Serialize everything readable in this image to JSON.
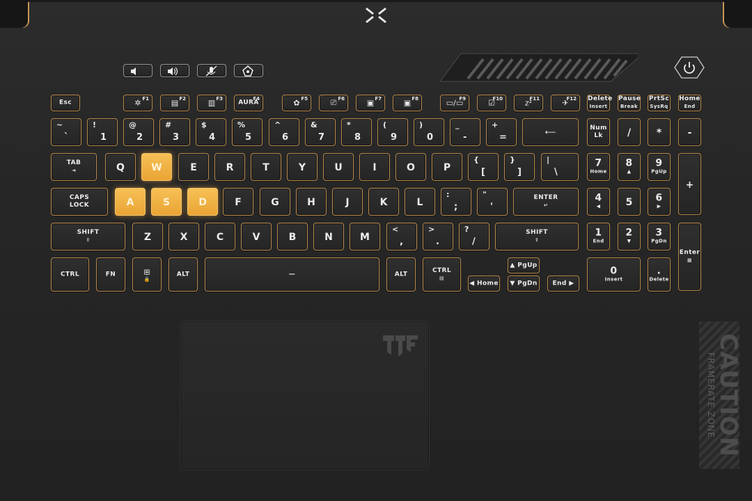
{
  "colors": {
    "accent": "#d4a061",
    "highlight": "#f2b548",
    "body": "#262626"
  },
  "hotkeys": [
    {
      "id": "vol-down",
      "icon": "volume-down-icon"
    },
    {
      "id": "vol-up",
      "icon": "volume-up-icon"
    },
    {
      "id": "mic-mute",
      "icon": "mic-mute-icon"
    },
    {
      "id": "armoury",
      "icon": "armoury-crate-icon"
    }
  ],
  "rows": {
    "fn": [
      {
        "label": "Esc"
      },
      {
        "fn": "F1",
        "icon": "✲"
      },
      {
        "fn": "F2",
        "icon": "▤"
      },
      {
        "fn": "F3",
        "icon": "▥"
      },
      {
        "fn": "F4",
        "label": "AURA"
      },
      {
        "fn": "F5",
        "icon": "✿"
      },
      {
        "fn": "F6",
        "icon": "⎚"
      },
      {
        "fn": "F7",
        "icon": "▣"
      },
      {
        "fn": "F8",
        "icon": "▣"
      },
      {
        "fn": "F9",
        "icon": "▭/▭"
      },
      {
        "fn": "F10",
        "icon": "☑"
      },
      {
        "fn": "F11",
        "icon": "z²"
      },
      {
        "fn": "F12",
        "icon": "✈"
      },
      {
        "label": "Delete",
        "sub": "Insert"
      },
      {
        "label": "Pause",
        "sub": "Break"
      },
      {
        "label": "PrtSc",
        "sub": "SysRq"
      },
      {
        "label": "Home",
        "sub": "End"
      }
    ],
    "num": [
      {
        "s": "~",
        "b": "`"
      },
      {
        "s": "!",
        "b": "1"
      },
      {
        "s": "@",
        "b": "2"
      },
      {
        "s": "#",
        "b": "3"
      },
      {
        "s": "$",
        "b": "4"
      },
      {
        "s": "%",
        "b": "5"
      },
      {
        "s": "^",
        "b": "6"
      },
      {
        "s": "&",
        "b": "7"
      },
      {
        "s": "*",
        "b": "8"
      },
      {
        "s": "(",
        "b": "9"
      },
      {
        "s": ")",
        "b": "0"
      },
      {
        "s": "_",
        "b": "-"
      },
      {
        "s": "+",
        "b": "="
      },
      {
        "icon": "⟵"
      },
      {
        "label": "Num Lk"
      },
      {
        "m": "/"
      },
      {
        "m": "*"
      },
      {
        "m": "-"
      }
    ],
    "qwerty": [
      {
        "label": "TAB",
        "sub": "⇥"
      },
      {
        "m": "Q"
      },
      {
        "m": "W",
        "hl": true
      },
      {
        "m": "E"
      },
      {
        "m": "R"
      },
      {
        "m": "T"
      },
      {
        "m": "Y"
      },
      {
        "m": "U"
      },
      {
        "m": "I"
      },
      {
        "m": "O"
      },
      {
        "m": "P"
      },
      {
        "s": "{",
        "b": "["
      },
      {
        "s": "}",
        "b": "]"
      },
      {
        "s": "|",
        "b": "\\"
      },
      {
        "m": "7",
        "sub": "Home"
      },
      {
        "m": "8",
        "sub": "▲"
      },
      {
        "m": "9",
        "sub": "PgUp"
      },
      {
        "m": "+"
      }
    ],
    "home": [
      {
        "label": "CAPS",
        "label2": "LOCK"
      },
      {
        "m": "A",
        "hl": true
      },
      {
        "m": "S",
        "hl": true
      },
      {
        "m": "D",
        "hl": true
      },
      {
        "m": "F"
      },
      {
        "m": "G"
      },
      {
        "m": "H"
      },
      {
        "m": "J"
      },
      {
        "m": "K"
      },
      {
        "m": "L"
      },
      {
        "s": ":",
        "b": ";"
      },
      {
        "s": "\"",
        "b": "'"
      },
      {
        "label": "ENTER",
        "sub": "↵"
      },
      {
        "m": "4",
        "sub": "◀"
      },
      {
        "m": "5"
      },
      {
        "m": "6",
        "sub": "▶"
      }
    ],
    "shift": [
      {
        "label": "SHIFT",
        "sub": "⇧"
      },
      {
        "m": "Z"
      },
      {
        "m": "X"
      },
      {
        "m": "C"
      },
      {
        "m": "V"
      },
      {
        "m": "B"
      },
      {
        "m": "N"
      },
      {
        "m": "M"
      },
      {
        "s": "<",
        "b": ","
      },
      {
        "s": ">",
        "b": "."
      },
      {
        "s": "?",
        "b": "/"
      },
      {
        "label": "SHIFT",
        "sub": "⇧"
      },
      {
        "m": "1",
        "sub": "End"
      },
      {
        "m": "2",
        "sub": "▼"
      },
      {
        "m": "3",
        "sub": "PgDn"
      },
      {
        "label": "Enter",
        "sub": "▦"
      }
    ],
    "bottom": [
      {
        "label": "CTRL"
      },
      {
        "label": "FN"
      },
      {
        "icon": "⊞",
        "sub": "🔒"
      },
      {
        "label": "ALT"
      },
      {
        "label": "—"
      },
      {
        "label": "ALT"
      },
      {
        "label": "CTRL",
        "sub": "▤"
      },
      {
        "label": "◀ Home"
      },
      {
        "label": "▲ PgUp"
      },
      {
        "label": "▼ PgDn"
      },
      {
        "label": "End ▶"
      },
      {
        "m": "0",
        "sub": "Insert"
      },
      {
        "m": ".",
        "sub": "Delete"
      }
    ]
  },
  "caution": {
    "line1": "CAUTION",
    "line2": "FRAMERATE ZONE"
  }
}
